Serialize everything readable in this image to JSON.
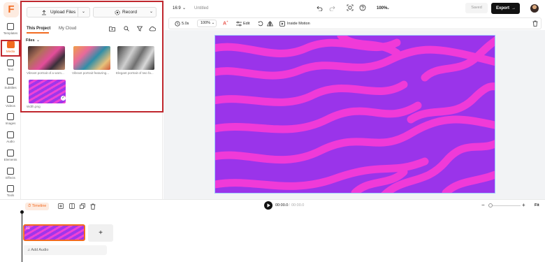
{
  "app": {
    "logo": "F",
    "title": "Untitled",
    "aspect": "16:9",
    "zoom": "100%",
    "saved_label": "Saved",
    "export_label": "Export"
  },
  "rail": [
    {
      "label": "Templates",
      "icon": "template-icon"
    },
    {
      "label": "Media",
      "icon": "media-icon",
      "active": true
    },
    {
      "label": "Text",
      "icon": "text-icon"
    },
    {
      "label": "Subtitles",
      "icon": "subtitles-icon"
    },
    {
      "label": "Videos",
      "icon": "videos-icon"
    },
    {
      "label": "Images",
      "icon": "images-icon"
    },
    {
      "label": "Audio",
      "icon": "audio-icon"
    },
    {
      "label": "Elements",
      "icon": "elements-icon"
    },
    {
      "label": "Effects",
      "icon": "effects-icon"
    },
    {
      "label": "Tools",
      "icon": "tools-icon"
    }
  ],
  "media": {
    "upload_label": "Upload Files",
    "record_label": "Record",
    "tabs": [
      "This Project",
      "My Cloud"
    ],
    "files_label": "Files",
    "items": [
      {
        "caption": "Vibrant portrait of a wom..."
      },
      {
        "caption": "Vibrant portrait featuring..."
      },
      {
        "caption": "Elegant portrait of two fa..."
      },
      {
        "caption": "Wdth.png"
      }
    ]
  },
  "toolbar": {
    "duration": "5.0s",
    "scale": "100%",
    "edit_label": "Edit",
    "motion_label": "Inside Motion"
  },
  "timeline": {
    "label": "Timeline",
    "current": "00:00.0",
    "total": "00:00.0",
    "separator": "/",
    "fit_label": "Fit",
    "clip_number": "01",
    "add_audio_label": "Add Audio"
  },
  "colors": {
    "accent": "#f26b21",
    "highlight": "#c0262d",
    "stripe_base": "#9a34ea",
    "stripe_wave": "#f03ad8"
  }
}
